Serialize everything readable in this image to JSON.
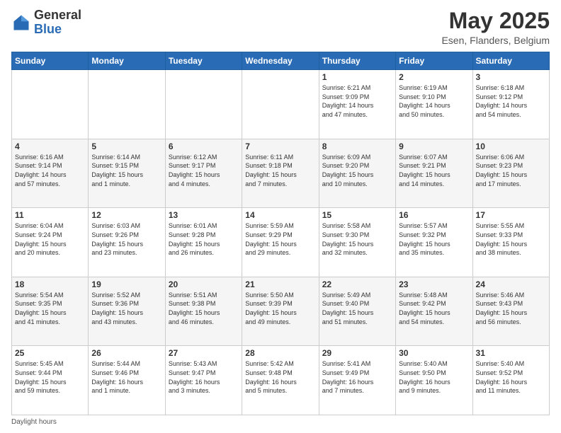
{
  "header": {
    "logo_general": "General",
    "logo_blue": "Blue",
    "month_title": "May 2025",
    "location": "Esen, Flanders, Belgium"
  },
  "days_of_week": [
    "Sunday",
    "Monday",
    "Tuesday",
    "Wednesday",
    "Thursday",
    "Friday",
    "Saturday"
  ],
  "footer": {
    "daylight_hours": "Daylight hours"
  },
  "weeks": [
    [
      {
        "day": "",
        "info": ""
      },
      {
        "day": "",
        "info": ""
      },
      {
        "day": "",
        "info": ""
      },
      {
        "day": "",
        "info": ""
      },
      {
        "day": "1",
        "info": "Sunrise: 6:21 AM\nSunset: 9:09 PM\nDaylight: 14 hours\nand 47 minutes."
      },
      {
        "day": "2",
        "info": "Sunrise: 6:19 AM\nSunset: 9:10 PM\nDaylight: 14 hours\nand 50 minutes."
      },
      {
        "day": "3",
        "info": "Sunrise: 6:18 AM\nSunset: 9:12 PM\nDaylight: 14 hours\nand 54 minutes."
      }
    ],
    [
      {
        "day": "4",
        "info": "Sunrise: 6:16 AM\nSunset: 9:14 PM\nDaylight: 14 hours\nand 57 minutes."
      },
      {
        "day": "5",
        "info": "Sunrise: 6:14 AM\nSunset: 9:15 PM\nDaylight: 15 hours\nand 1 minute."
      },
      {
        "day": "6",
        "info": "Sunrise: 6:12 AM\nSunset: 9:17 PM\nDaylight: 15 hours\nand 4 minutes."
      },
      {
        "day": "7",
        "info": "Sunrise: 6:11 AM\nSunset: 9:18 PM\nDaylight: 15 hours\nand 7 minutes."
      },
      {
        "day": "8",
        "info": "Sunrise: 6:09 AM\nSunset: 9:20 PM\nDaylight: 15 hours\nand 10 minutes."
      },
      {
        "day": "9",
        "info": "Sunrise: 6:07 AM\nSunset: 9:21 PM\nDaylight: 15 hours\nand 14 minutes."
      },
      {
        "day": "10",
        "info": "Sunrise: 6:06 AM\nSunset: 9:23 PM\nDaylight: 15 hours\nand 17 minutes."
      }
    ],
    [
      {
        "day": "11",
        "info": "Sunrise: 6:04 AM\nSunset: 9:24 PM\nDaylight: 15 hours\nand 20 minutes."
      },
      {
        "day": "12",
        "info": "Sunrise: 6:03 AM\nSunset: 9:26 PM\nDaylight: 15 hours\nand 23 minutes."
      },
      {
        "day": "13",
        "info": "Sunrise: 6:01 AM\nSunset: 9:28 PM\nDaylight: 15 hours\nand 26 minutes."
      },
      {
        "day": "14",
        "info": "Sunrise: 5:59 AM\nSunset: 9:29 PM\nDaylight: 15 hours\nand 29 minutes."
      },
      {
        "day": "15",
        "info": "Sunrise: 5:58 AM\nSunset: 9:30 PM\nDaylight: 15 hours\nand 32 minutes."
      },
      {
        "day": "16",
        "info": "Sunrise: 5:57 AM\nSunset: 9:32 PM\nDaylight: 15 hours\nand 35 minutes."
      },
      {
        "day": "17",
        "info": "Sunrise: 5:55 AM\nSunset: 9:33 PM\nDaylight: 15 hours\nand 38 minutes."
      }
    ],
    [
      {
        "day": "18",
        "info": "Sunrise: 5:54 AM\nSunset: 9:35 PM\nDaylight: 15 hours\nand 41 minutes."
      },
      {
        "day": "19",
        "info": "Sunrise: 5:52 AM\nSunset: 9:36 PM\nDaylight: 15 hours\nand 43 minutes."
      },
      {
        "day": "20",
        "info": "Sunrise: 5:51 AM\nSunset: 9:38 PM\nDaylight: 15 hours\nand 46 minutes."
      },
      {
        "day": "21",
        "info": "Sunrise: 5:50 AM\nSunset: 9:39 PM\nDaylight: 15 hours\nand 49 minutes."
      },
      {
        "day": "22",
        "info": "Sunrise: 5:49 AM\nSunset: 9:40 PM\nDaylight: 15 hours\nand 51 minutes."
      },
      {
        "day": "23",
        "info": "Sunrise: 5:48 AM\nSunset: 9:42 PM\nDaylight: 15 hours\nand 54 minutes."
      },
      {
        "day": "24",
        "info": "Sunrise: 5:46 AM\nSunset: 9:43 PM\nDaylight: 15 hours\nand 56 minutes."
      }
    ],
    [
      {
        "day": "25",
        "info": "Sunrise: 5:45 AM\nSunset: 9:44 PM\nDaylight: 15 hours\nand 59 minutes."
      },
      {
        "day": "26",
        "info": "Sunrise: 5:44 AM\nSunset: 9:46 PM\nDaylight: 16 hours\nand 1 minute."
      },
      {
        "day": "27",
        "info": "Sunrise: 5:43 AM\nSunset: 9:47 PM\nDaylight: 16 hours\nand 3 minutes."
      },
      {
        "day": "28",
        "info": "Sunrise: 5:42 AM\nSunset: 9:48 PM\nDaylight: 16 hours\nand 5 minutes."
      },
      {
        "day": "29",
        "info": "Sunrise: 5:41 AM\nSunset: 9:49 PM\nDaylight: 16 hours\nand 7 minutes."
      },
      {
        "day": "30",
        "info": "Sunrise: 5:40 AM\nSunset: 9:50 PM\nDaylight: 16 hours\nand 9 minutes."
      },
      {
        "day": "31",
        "info": "Sunrise: 5:40 AM\nSunset: 9:52 PM\nDaylight: 16 hours\nand 11 minutes."
      }
    ]
  ]
}
